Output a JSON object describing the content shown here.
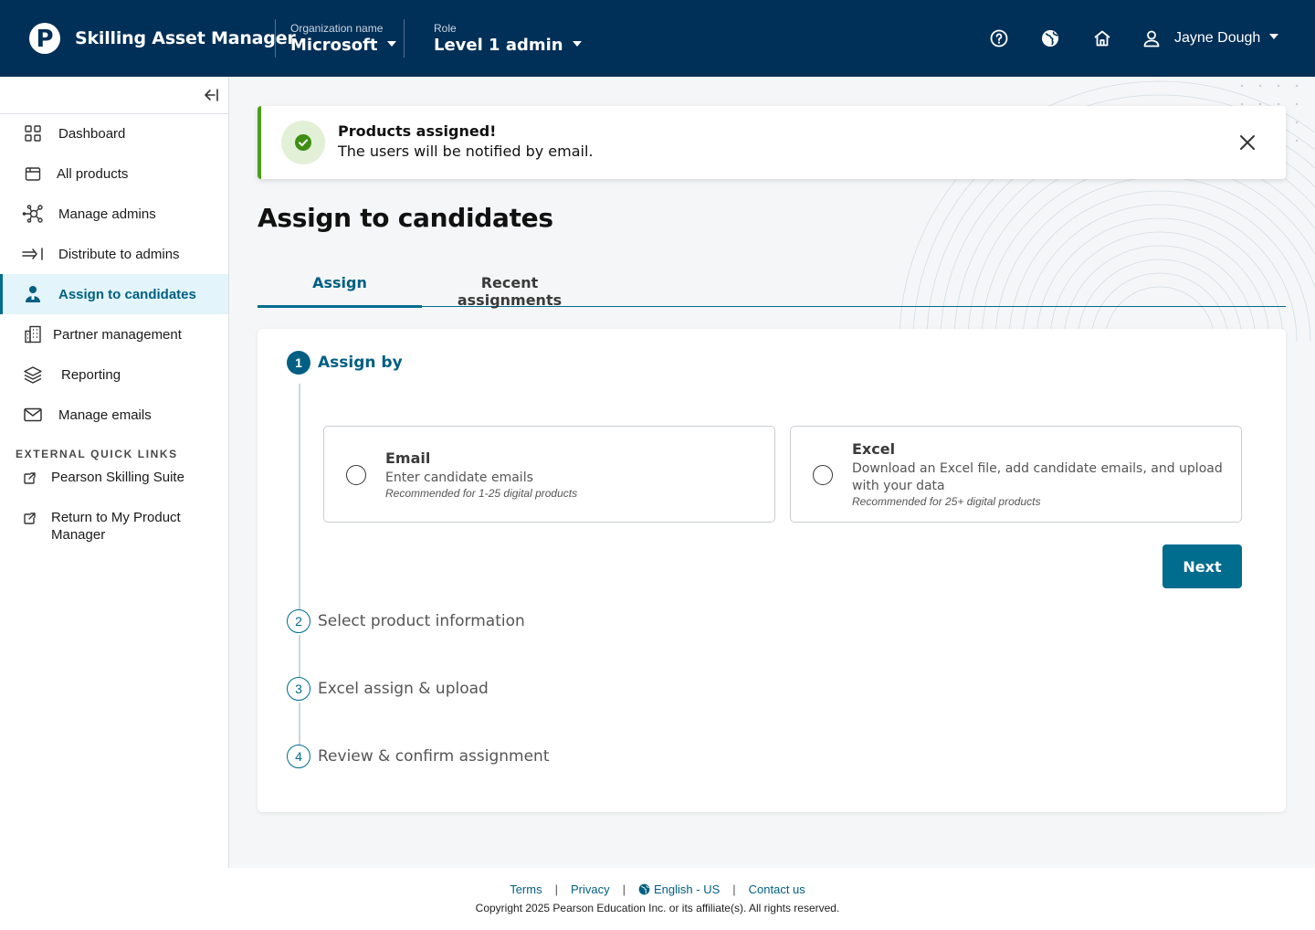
{
  "header": {
    "logo_letter": "P",
    "app_title": "Skilling Asset Manager",
    "org_label": "Organization name",
    "org_value": "Microsoft",
    "role_label": "Role",
    "role_value": "Level 1 admin",
    "user_name": "Jayne Dough"
  },
  "sidebar": {
    "items": [
      {
        "label": "Dashboard",
        "icon": "grid-icon"
      },
      {
        "label": "All products",
        "icon": "box-icon"
      },
      {
        "label": "Manage admins",
        "icon": "network-icon"
      },
      {
        "label": "Distribute to admins",
        "icon": "arrow-right-bar-icon"
      },
      {
        "label": "Assign to candidates",
        "icon": "person-icon",
        "active": true
      },
      {
        "label": "Partner management",
        "icon": "building-icon"
      },
      {
        "label": "Reporting",
        "icon": "layers-icon"
      },
      {
        "label": "Manage emails",
        "icon": "envelope-icon"
      }
    ],
    "external_heading": "EXTERNAL QUICK LINKS",
    "external_links": [
      {
        "label": "Pearson Skilling Suite"
      },
      {
        "label": "Return to My Product Manager"
      }
    ]
  },
  "toast": {
    "title": "Products assigned!",
    "message": "The users will be notified by email."
  },
  "page": {
    "title": "Assign to candidates",
    "tabs": [
      {
        "label": "Assign",
        "active": true
      },
      {
        "label": "Recent assignments"
      }
    ]
  },
  "stepper": {
    "steps": [
      {
        "number": "1",
        "label": "Assign by",
        "state": "active"
      },
      {
        "number": "2",
        "label": "Select product information",
        "state": "todo"
      },
      {
        "number": "3",
        "label": "Excel assign & upload",
        "state": "todo"
      },
      {
        "number": "4",
        "label": "Review & confirm assignment",
        "state": "todo"
      }
    ],
    "options": [
      {
        "title": "Email",
        "description": "Enter candidate emails",
        "recommendation": "Recommended for 1-25 digital products"
      },
      {
        "title": "Excel",
        "description": "Download an Excel file, add candidate emails, and upload with your data",
        "recommendation": "Recommended for 25+ digital products"
      }
    ],
    "next_label": "Next"
  },
  "footer": {
    "links": [
      "Terms",
      "Privacy",
      "English - US",
      "Contact us"
    ],
    "copyright": "Copyright 2025 Pearson Education Inc. or its affiliate(s). All rights reserved."
  },
  "colors": {
    "header_bg": "#002f57",
    "accent": "#006c8e",
    "active_nav_bg": "#e3f5fb",
    "success": "#4a9e17"
  }
}
